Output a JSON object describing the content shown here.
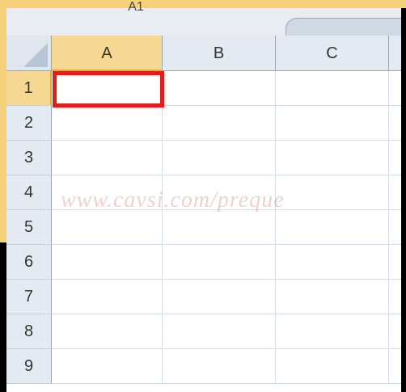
{
  "namebox": {
    "value": "A1"
  },
  "columns": [
    {
      "label": "A",
      "active": true
    },
    {
      "label": "B",
      "active": false
    },
    {
      "label": "C",
      "active": false
    }
  ],
  "rows": [
    {
      "label": "1",
      "active": true
    },
    {
      "label": "2",
      "active": false
    },
    {
      "label": "3",
      "active": false
    },
    {
      "label": "4",
      "active": false
    },
    {
      "label": "5",
      "active": false
    },
    {
      "label": "6",
      "active": false
    },
    {
      "label": "7",
      "active": false
    },
    {
      "label": "8",
      "active": false
    },
    {
      "label": "9",
      "active": false
    }
  ],
  "selected_cell": "A1",
  "watermark": {
    "text": "www.cavsi.com/preque"
  },
  "colors": {
    "selection_border": "#e21b1b",
    "active_header": "#f7d892",
    "header": "#e4eaf1",
    "frame": "#f5d27a"
  }
}
